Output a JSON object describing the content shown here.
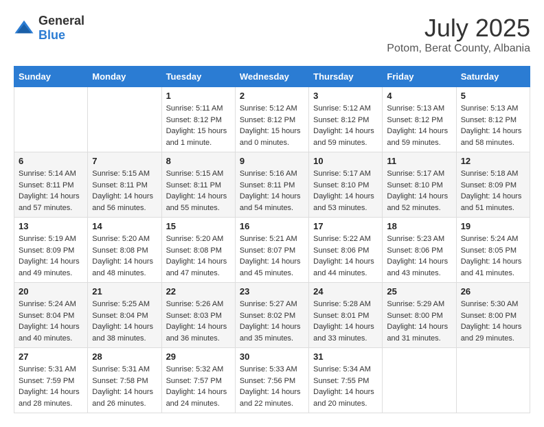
{
  "logo": {
    "general": "General",
    "blue": "Blue"
  },
  "header": {
    "month_year": "July 2025",
    "location": "Potom, Berat County, Albania"
  },
  "weekdays": [
    "Sunday",
    "Monday",
    "Tuesday",
    "Wednesday",
    "Thursday",
    "Friday",
    "Saturday"
  ],
  "weeks": [
    [
      {
        "day": "",
        "sunrise": "",
        "sunset": "",
        "daylight": ""
      },
      {
        "day": "",
        "sunrise": "",
        "sunset": "",
        "daylight": ""
      },
      {
        "day": "1",
        "sunrise": "Sunrise: 5:11 AM",
        "sunset": "Sunset: 8:12 PM",
        "daylight": "Daylight: 15 hours and 1 minute."
      },
      {
        "day": "2",
        "sunrise": "Sunrise: 5:12 AM",
        "sunset": "Sunset: 8:12 PM",
        "daylight": "Daylight: 15 hours and 0 minutes."
      },
      {
        "day": "3",
        "sunrise": "Sunrise: 5:12 AM",
        "sunset": "Sunset: 8:12 PM",
        "daylight": "Daylight: 14 hours and 59 minutes."
      },
      {
        "day": "4",
        "sunrise": "Sunrise: 5:13 AM",
        "sunset": "Sunset: 8:12 PM",
        "daylight": "Daylight: 14 hours and 59 minutes."
      },
      {
        "day": "5",
        "sunrise": "Sunrise: 5:13 AM",
        "sunset": "Sunset: 8:12 PM",
        "daylight": "Daylight: 14 hours and 58 minutes."
      }
    ],
    [
      {
        "day": "6",
        "sunrise": "Sunrise: 5:14 AM",
        "sunset": "Sunset: 8:11 PM",
        "daylight": "Daylight: 14 hours and 57 minutes."
      },
      {
        "day": "7",
        "sunrise": "Sunrise: 5:15 AM",
        "sunset": "Sunset: 8:11 PM",
        "daylight": "Daylight: 14 hours and 56 minutes."
      },
      {
        "day": "8",
        "sunrise": "Sunrise: 5:15 AM",
        "sunset": "Sunset: 8:11 PM",
        "daylight": "Daylight: 14 hours and 55 minutes."
      },
      {
        "day": "9",
        "sunrise": "Sunrise: 5:16 AM",
        "sunset": "Sunset: 8:11 PM",
        "daylight": "Daylight: 14 hours and 54 minutes."
      },
      {
        "day": "10",
        "sunrise": "Sunrise: 5:17 AM",
        "sunset": "Sunset: 8:10 PM",
        "daylight": "Daylight: 14 hours and 53 minutes."
      },
      {
        "day": "11",
        "sunrise": "Sunrise: 5:17 AM",
        "sunset": "Sunset: 8:10 PM",
        "daylight": "Daylight: 14 hours and 52 minutes."
      },
      {
        "day": "12",
        "sunrise": "Sunrise: 5:18 AM",
        "sunset": "Sunset: 8:09 PM",
        "daylight": "Daylight: 14 hours and 51 minutes."
      }
    ],
    [
      {
        "day": "13",
        "sunrise": "Sunrise: 5:19 AM",
        "sunset": "Sunset: 8:09 PM",
        "daylight": "Daylight: 14 hours and 49 minutes."
      },
      {
        "day": "14",
        "sunrise": "Sunrise: 5:20 AM",
        "sunset": "Sunset: 8:08 PM",
        "daylight": "Daylight: 14 hours and 48 minutes."
      },
      {
        "day": "15",
        "sunrise": "Sunrise: 5:20 AM",
        "sunset": "Sunset: 8:08 PM",
        "daylight": "Daylight: 14 hours and 47 minutes."
      },
      {
        "day": "16",
        "sunrise": "Sunrise: 5:21 AM",
        "sunset": "Sunset: 8:07 PM",
        "daylight": "Daylight: 14 hours and 45 minutes."
      },
      {
        "day": "17",
        "sunrise": "Sunrise: 5:22 AM",
        "sunset": "Sunset: 8:06 PM",
        "daylight": "Daylight: 14 hours and 44 minutes."
      },
      {
        "day": "18",
        "sunrise": "Sunrise: 5:23 AM",
        "sunset": "Sunset: 8:06 PM",
        "daylight": "Daylight: 14 hours and 43 minutes."
      },
      {
        "day": "19",
        "sunrise": "Sunrise: 5:24 AM",
        "sunset": "Sunset: 8:05 PM",
        "daylight": "Daylight: 14 hours and 41 minutes."
      }
    ],
    [
      {
        "day": "20",
        "sunrise": "Sunrise: 5:24 AM",
        "sunset": "Sunset: 8:04 PM",
        "daylight": "Daylight: 14 hours and 40 minutes."
      },
      {
        "day": "21",
        "sunrise": "Sunrise: 5:25 AM",
        "sunset": "Sunset: 8:04 PM",
        "daylight": "Daylight: 14 hours and 38 minutes."
      },
      {
        "day": "22",
        "sunrise": "Sunrise: 5:26 AM",
        "sunset": "Sunset: 8:03 PM",
        "daylight": "Daylight: 14 hours and 36 minutes."
      },
      {
        "day": "23",
        "sunrise": "Sunrise: 5:27 AM",
        "sunset": "Sunset: 8:02 PM",
        "daylight": "Daylight: 14 hours and 35 minutes."
      },
      {
        "day": "24",
        "sunrise": "Sunrise: 5:28 AM",
        "sunset": "Sunset: 8:01 PM",
        "daylight": "Daylight: 14 hours and 33 minutes."
      },
      {
        "day": "25",
        "sunrise": "Sunrise: 5:29 AM",
        "sunset": "Sunset: 8:00 PM",
        "daylight": "Daylight: 14 hours and 31 minutes."
      },
      {
        "day": "26",
        "sunrise": "Sunrise: 5:30 AM",
        "sunset": "Sunset: 8:00 PM",
        "daylight": "Daylight: 14 hours and 29 minutes."
      }
    ],
    [
      {
        "day": "27",
        "sunrise": "Sunrise: 5:31 AM",
        "sunset": "Sunset: 7:59 PM",
        "daylight": "Daylight: 14 hours and 28 minutes."
      },
      {
        "day": "28",
        "sunrise": "Sunrise: 5:31 AM",
        "sunset": "Sunset: 7:58 PM",
        "daylight": "Daylight: 14 hours and 26 minutes."
      },
      {
        "day": "29",
        "sunrise": "Sunrise: 5:32 AM",
        "sunset": "Sunset: 7:57 PM",
        "daylight": "Daylight: 14 hours and 24 minutes."
      },
      {
        "day": "30",
        "sunrise": "Sunrise: 5:33 AM",
        "sunset": "Sunset: 7:56 PM",
        "daylight": "Daylight: 14 hours and 22 minutes."
      },
      {
        "day": "31",
        "sunrise": "Sunrise: 5:34 AM",
        "sunset": "Sunset: 7:55 PM",
        "daylight": "Daylight: 14 hours and 20 minutes."
      },
      {
        "day": "",
        "sunrise": "",
        "sunset": "",
        "daylight": ""
      },
      {
        "day": "",
        "sunrise": "",
        "sunset": "",
        "daylight": ""
      }
    ]
  ]
}
